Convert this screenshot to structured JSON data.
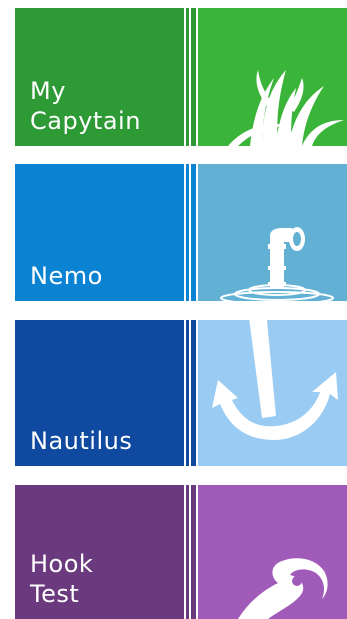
{
  "tiles": [
    {
      "label": "My\nCapytain",
      "icon": "grass-icon",
      "colors": {
        "label_bg": "#2e9a35",
        "stripe": "#2e9a35",
        "icon_bg": "#3ab53a"
      }
    },
    {
      "label": "Nemo",
      "icon": "periscope-icon",
      "colors": {
        "label_bg": "#0b82d2",
        "stripe": "#0b82d2",
        "icon_bg": "#62b0d4"
      }
    },
    {
      "label": "Nautilus",
      "icon": "anchor-icon",
      "colors": {
        "label_bg": "#0f4aa0",
        "stripe": "#0f4aa0",
        "icon_bg": "#9acbf3"
      }
    },
    {
      "label": "Hook\nTest",
      "icon": "hook-icon",
      "colors": {
        "label_bg": "#6b3a7e",
        "stripe": "#6b3a7e",
        "icon_bg": "#a05bb8"
      }
    }
  ]
}
